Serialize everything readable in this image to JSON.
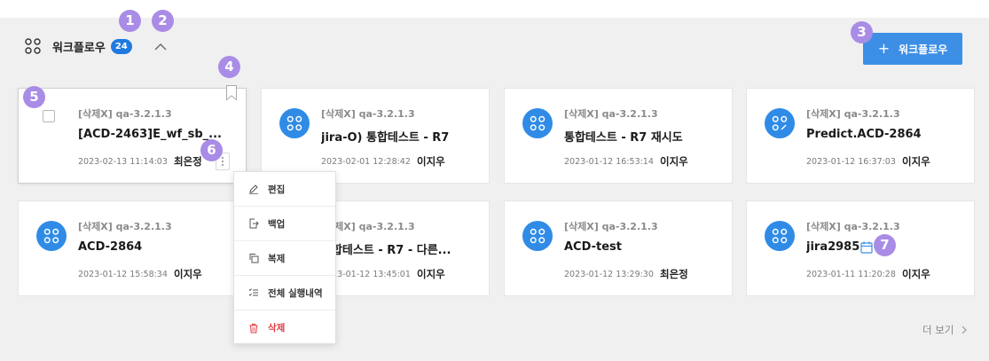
{
  "section": {
    "title": "워크플로우",
    "count": "24",
    "add_label": "워크플로우"
  },
  "callouts": [
    "1",
    "2",
    "3",
    "4",
    "5",
    "6",
    "7"
  ],
  "cards": [
    {
      "project": "[삭제X] qa-3.2.1.3",
      "name": "[ACD-2463]E_wf_sb_...",
      "date": "2023-02-13 11:14:03",
      "author": "최은정"
    },
    {
      "project": "[삭제X] qa-3.2.1.3",
      "name": "jira-O) 통합테스트 - R7",
      "date": "2023-02-01 12:28:42",
      "author": "이지우"
    },
    {
      "project": "[삭제X] qa-3.2.1.3",
      "name": "통합테스트 - R7 재시도",
      "date": "2023-01-12 16:53:14",
      "author": "이지우"
    },
    {
      "project": "[삭제X] qa-3.2.1.3",
      "name": "Predict.ACD-2864",
      "date": "2023-01-12 16:37:03",
      "author": "이지우"
    },
    {
      "project": "[삭제X] qa-3.2.1.3",
      "name": "ACD-2864",
      "date": "2023-01-12 15:58:34",
      "author": "이지우"
    },
    {
      "project": "[삭제X] qa-3.2.1.3",
      "name": "통합테스트 - R7 - 다른...",
      "date": "2023-01-12 13:45:01",
      "author": "이지우"
    },
    {
      "project": "[삭제X] qa-3.2.1.3",
      "name": "ACD-test",
      "date": "2023-01-12 13:29:30",
      "author": "최은정"
    },
    {
      "project": "[삭제X] qa-3.2.1.3",
      "name": "jira2985",
      "date": "2023-01-11 11:20:28",
      "author": "이지우"
    }
  ],
  "menu": {
    "items": [
      {
        "label": "편집",
        "icon": "pencil-icon"
      },
      {
        "label": "백업",
        "icon": "export-icon"
      },
      {
        "label": "복제",
        "icon": "copy-icon"
      },
      {
        "label": "전체 실행내역",
        "icon": "checklist-icon"
      },
      {
        "label": "삭제",
        "icon": "trash-icon"
      }
    ]
  },
  "more_label": "더 보기",
  "colors": {
    "accent": "#2f8be6",
    "badge": "#1f7ae0",
    "callout": "#a98ce6",
    "danger": "#e0393e"
  }
}
